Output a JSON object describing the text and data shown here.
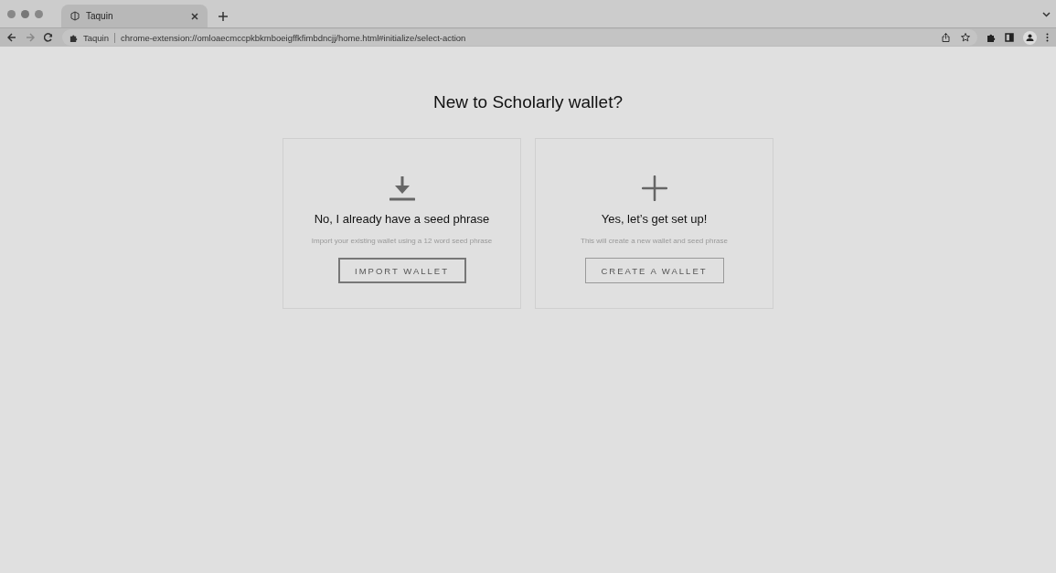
{
  "browser": {
    "tab": {
      "title": "Taquin",
      "selected": true
    },
    "address_bar": {
      "site_label": "Taquin",
      "url": "chrome-extension://omloaecmccpkbkmboeigffkfimbdncjj/home.html#initialize/select-action"
    }
  },
  "page": {
    "heading": "New to Scholarly wallet?",
    "options": [
      {
        "kind": "import",
        "title": "No, I already have a seed phrase",
        "description": "Import your existing wallet using a 12 word seed phrase",
        "button": "IMPORT WALLET",
        "focused": true
      },
      {
        "kind": "create",
        "title": "Yes, let’s get set up!",
        "description": "This will create a new wallet and seed phrase",
        "button": "CREATE A WALLET",
        "focused": false
      }
    ]
  }
}
